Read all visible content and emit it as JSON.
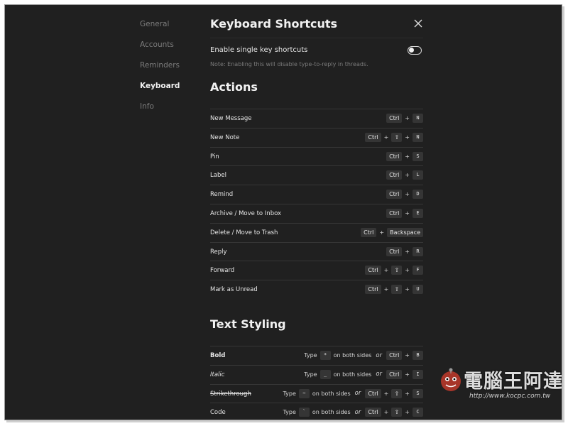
{
  "sidebar": {
    "items": [
      {
        "label": "General"
      },
      {
        "label": "Accounts"
      },
      {
        "label": "Reminders"
      },
      {
        "label": "Keyboard"
      },
      {
        "label": "Info"
      }
    ],
    "active_index": 3
  },
  "header": {
    "title": "Keyboard Shortcuts"
  },
  "single_key": {
    "label": "Enable single key shortcuts",
    "enabled": false,
    "note": "Note: Enabling this will disable type-to-reply in threads."
  },
  "actions": {
    "title": "Actions",
    "rows": [
      {
        "label": "New Message",
        "keys": [
          "Ctrl",
          "N"
        ]
      },
      {
        "label": "New Note",
        "keys": [
          "Ctrl",
          "⇧",
          "N"
        ]
      },
      {
        "label": "Pin",
        "keys": [
          "Ctrl",
          "S"
        ]
      },
      {
        "label": "Label",
        "keys": [
          "Ctrl",
          "L"
        ]
      },
      {
        "label": "Remind",
        "keys": [
          "Ctrl",
          "D"
        ]
      },
      {
        "label": "Archive / Move to Inbox",
        "keys": [
          "Ctrl",
          "E"
        ]
      },
      {
        "label": "Delete / Move to Trash",
        "keys": [
          "Ctrl",
          "Backspace"
        ]
      },
      {
        "label": "Reply",
        "keys": [
          "Ctrl",
          "R"
        ]
      },
      {
        "label": "Forward",
        "keys": [
          "Ctrl",
          "⇧",
          "F"
        ]
      },
      {
        "label": "Mark as Unread",
        "keys": [
          "Ctrl",
          "⇧",
          "U"
        ]
      }
    ]
  },
  "text_styling": {
    "title": "Text Styling",
    "type_word": "Type",
    "sides_text": "on both sides",
    "or_word": "or",
    "rows": [
      {
        "label": "Bold",
        "style": "bold",
        "char": "*",
        "keys": [
          "Ctrl",
          "B"
        ]
      },
      {
        "label": "Italic",
        "style": "italic",
        "char": "_",
        "keys": [
          "Ctrl",
          "I"
        ]
      },
      {
        "label": "Strikethrough",
        "style": "strike",
        "char": "~",
        "keys": [
          "Ctrl",
          "⇧",
          "S"
        ]
      },
      {
        "label": "Code",
        "style": "normal",
        "char": "`",
        "keys": [
          "Ctrl",
          "⇧",
          "C"
        ]
      }
    ]
  },
  "watermark": {
    "text": "電腦王阿達",
    "url": "http://www.kocpc.com.tw"
  },
  "colors": {
    "background": "#202020",
    "key_bg": "#353535",
    "divider": "#363636",
    "text": "#e6e6e6",
    "muted": "#7c7c7c"
  }
}
